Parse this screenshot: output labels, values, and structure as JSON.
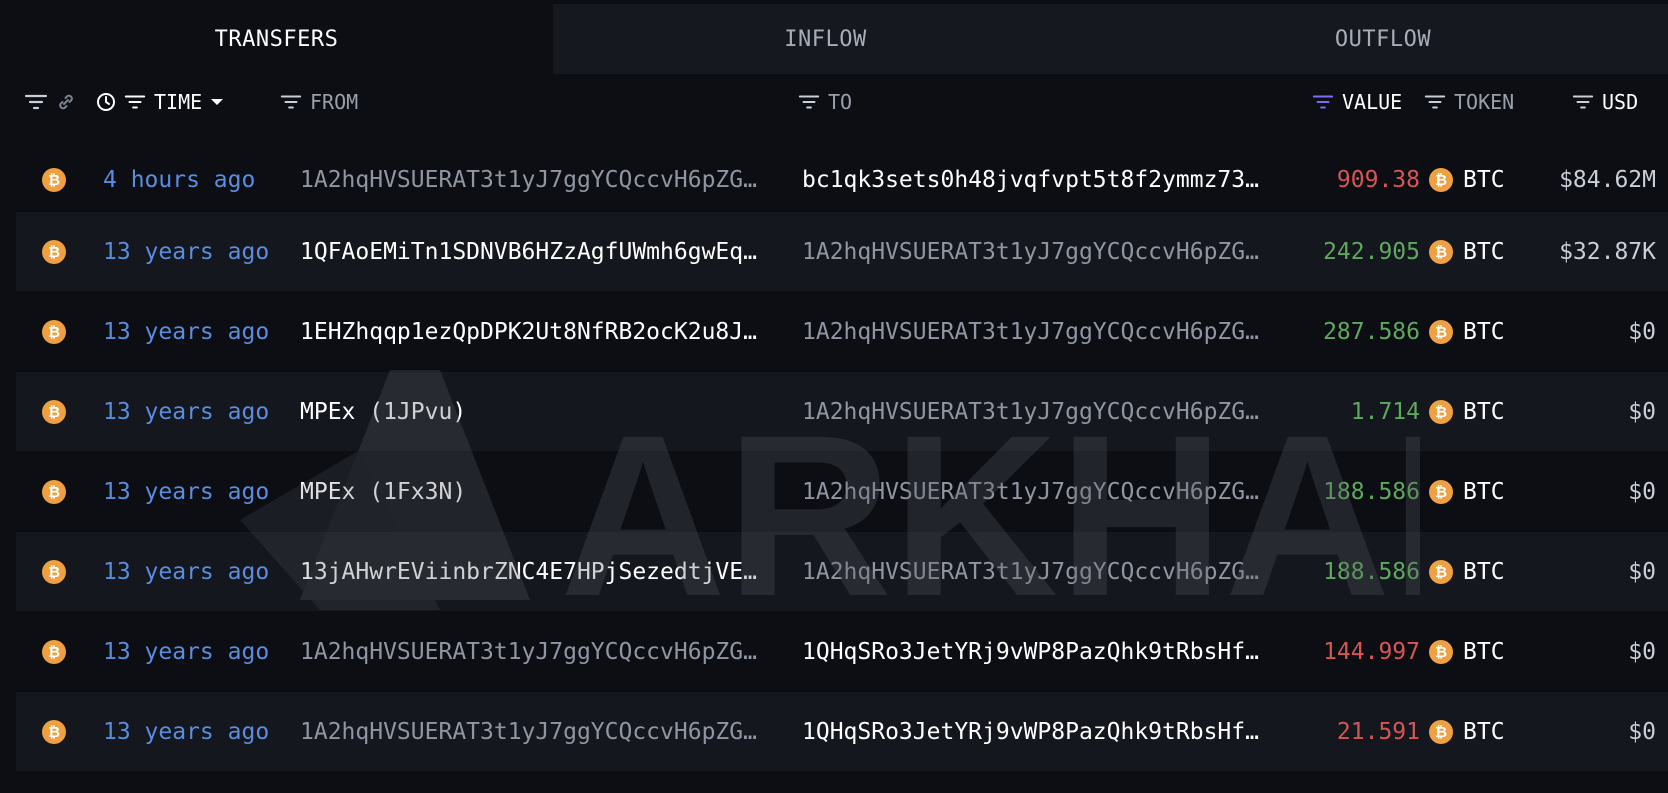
{
  "tabs": [
    {
      "label": "TRANSFERS",
      "active": true
    },
    {
      "label": "INFLOW",
      "active": false
    },
    {
      "label": "OUTFLOW",
      "active": false
    }
  ],
  "columns": {
    "time": "TIME",
    "from": "FROM",
    "to": "TO",
    "value": "VALUE",
    "token": "TOKEN",
    "usd": "USD"
  },
  "watermark": "ARKHAM",
  "colors": {
    "background": "#0c0e14",
    "row_alt": "#15171e",
    "time_link": "#5b8dde",
    "value_out": "#d65656",
    "value_in": "#5fa85f",
    "btc_icon": "#f0a040",
    "value_filter_active": "#7b6cf6"
  },
  "rows": [
    {
      "icon": "bitcoin-icon",
      "time": "4 hours ago",
      "from": "1A2hqHVSUERAT3t1yJ7ggYCQccvH6pZG…",
      "to": "bc1qk3sets0h48jvqfvpt5t8f2ymmz73…",
      "value": "909.38",
      "direction": "out",
      "token": "BTC",
      "usd": "$84.62M"
    },
    {
      "icon": "bitcoin-icon",
      "time": "13 years ago",
      "from": "1QFAoEMiTn1SDNVB6HZzAgfUWmh6gwEq…",
      "to": "1A2hqHVSUERAT3t1yJ7ggYCQccvH6pZG…",
      "value": "242.905",
      "direction": "in",
      "token": "BTC",
      "usd": "$32.87K"
    },
    {
      "icon": "bitcoin-icon",
      "time": "13 years ago",
      "from": "1EHZhqqp1ezQpDPK2Ut8NfRB2ocK2u8J…",
      "to": "1A2hqHVSUERAT3t1yJ7ggYCQccvH6pZG…",
      "value": "287.586",
      "direction": "in",
      "token": "BTC",
      "usd": "$0"
    },
    {
      "icon": "bitcoin-icon",
      "time": "13 years ago",
      "from": "MPEx (1JPvu)",
      "to": "1A2hqHVSUERAT3t1yJ7ggYCQccvH6pZG…",
      "value": "1.714",
      "direction": "in",
      "token": "BTC",
      "usd": "$0"
    },
    {
      "icon": "bitcoin-icon",
      "time": "13 years ago",
      "from": "MPEx (1Fx3N)",
      "to": "1A2hqHVSUERAT3t1yJ7ggYCQccvH6pZG…",
      "value": "188.586",
      "direction": "in",
      "token": "BTC",
      "usd": "$0"
    },
    {
      "icon": "bitcoin-icon",
      "time": "13 years ago",
      "from": "13jAHwrEViinbrZNC4E7HPjSezedtjVE…",
      "to": "1A2hqHVSUERAT3t1yJ7ggYCQccvH6pZG…",
      "value": "188.586",
      "direction": "in",
      "token": "BTC",
      "usd": "$0"
    },
    {
      "icon": "bitcoin-icon",
      "time": "13 years ago",
      "from": "1A2hqHVSUERAT3t1yJ7ggYCQccvH6pZG…",
      "to": "1QHqSRo3JetYRj9vWP8PazQhk9tRbsHf…",
      "value": "144.997",
      "direction": "out",
      "token": "BTC",
      "usd": "$0"
    },
    {
      "icon": "bitcoin-icon",
      "time": "13 years ago",
      "from": "1A2hqHVSUERAT3t1yJ7ggYCQccvH6pZG…",
      "to": "1QHqSRo3JetYRj9vWP8PazQhk9tRbsHf…",
      "value": "21.591",
      "direction": "out",
      "token": "BTC",
      "usd": "$0"
    }
  ]
}
